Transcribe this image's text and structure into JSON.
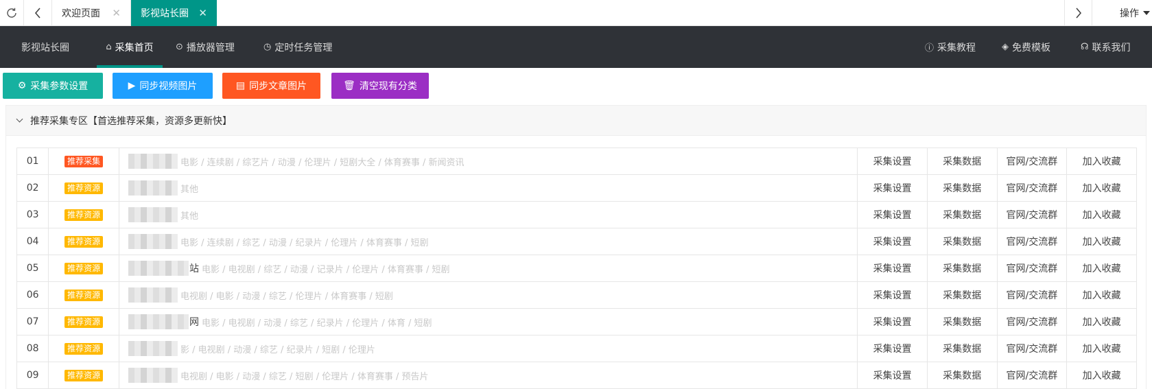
{
  "tabbar": {
    "tab1_label": "欢迎页面",
    "tab2_label": "影视站长圈",
    "ops_label": "操作"
  },
  "nav": {
    "brand": "影视站长圈",
    "items": [
      {
        "label": "采集首页",
        "icon": "home-icon",
        "active": true
      },
      {
        "label": "播放器管理",
        "icon": "play-circle-icon"
      },
      {
        "label": "定时任务管理",
        "icon": "clock-icon"
      }
    ],
    "right_items": [
      {
        "label": "采集教程",
        "icon": "help-icon"
      },
      {
        "label": "免费模板",
        "icon": "layers-icon"
      },
      {
        "label": "联系我们",
        "icon": "headset-icon"
      }
    ]
  },
  "buttons": [
    {
      "label": "采集参数设置",
      "color": "#16b1a0",
      "icon": "gear-icon"
    },
    {
      "label": "同步视频图片",
      "color": "#1e9fff",
      "icon": "video-icon"
    },
    {
      "label": "同步文章图片",
      "color": "#ff5722",
      "icon": "document-icon"
    },
    {
      "label": "清空现有分类",
      "color": "#9b2ec4",
      "icon": "trash-icon"
    }
  ],
  "panel": {
    "title": "推荐采集专区【首选推荐采集，资源多更新快】"
  },
  "colors": {
    "badge_primary": "#ff5722",
    "badge_secondary": "#ffb800",
    "accent": "#009688",
    "nav_bg": "#2f3237"
  },
  "actions": [
    "采集设置",
    "采集数据",
    "官网/交流群",
    "加入收藏"
  ],
  "rows": [
    {
      "idx": "01",
      "badge": "推荐采集",
      "badge_type": "primary",
      "suffix": "",
      "cats": "电影 / 连续剧 / 综艺片 / 动漫 / 伦理片 / 短剧大全 / 体育赛事 / 新闻资讯"
    },
    {
      "idx": "02",
      "badge": "推荐资源",
      "badge_type": "secondary",
      "suffix": "",
      "cats": "其他"
    },
    {
      "idx": "03",
      "badge": "推荐资源",
      "badge_type": "secondary",
      "suffix": "",
      "cats": "其他"
    },
    {
      "idx": "04",
      "badge": "推荐资源",
      "badge_type": "secondary",
      "suffix": "",
      "cats": "电影 / 连续剧 / 综艺 / 动漫 / 纪录片 / 伦理片 / 体育赛事 / 短剧"
    },
    {
      "idx": "05",
      "badge": "推荐资源",
      "badge_type": "secondary",
      "suffix": "站",
      "cats": "电影 / 电视剧 / 综艺 / 动漫 / 记录片 / 伦理片 / 体育赛事 / 短剧"
    },
    {
      "idx": "06",
      "badge": "推荐资源",
      "badge_type": "secondary",
      "suffix": "",
      "cats": "电视剧 / 电影 / 动漫 / 综艺 / 伦理片 / 体育赛事 / 短剧"
    },
    {
      "idx": "07",
      "badge": "推荐资源",
      "badge_type": "secondary",
      "suffix": "网",
      "cats": "电影 / 电视剧 / 动漫 / 综艺 / 纪录片 / 伦理片 / 体育 / 短剧"
    },
    {
      "idx": "08",
      "badge": "推荐资源",
      "badge_type": "secondary",
      "suffix": "",
      "cats": "影 / 电视剧 / 动漫 / 综艺 / 纪录片 / 短剧 / 伦理片"
    },
    {
      "idx": "09",
      "badge": "推荐资源",
      "badge_type": "secondary",
      "suffix": "",
      "cats": "电视剧 / 电影 / 动漫 / 综艺 / 短剧 / 伦理片 / 体育赛事 / 预告片"
    }
  ]
}
